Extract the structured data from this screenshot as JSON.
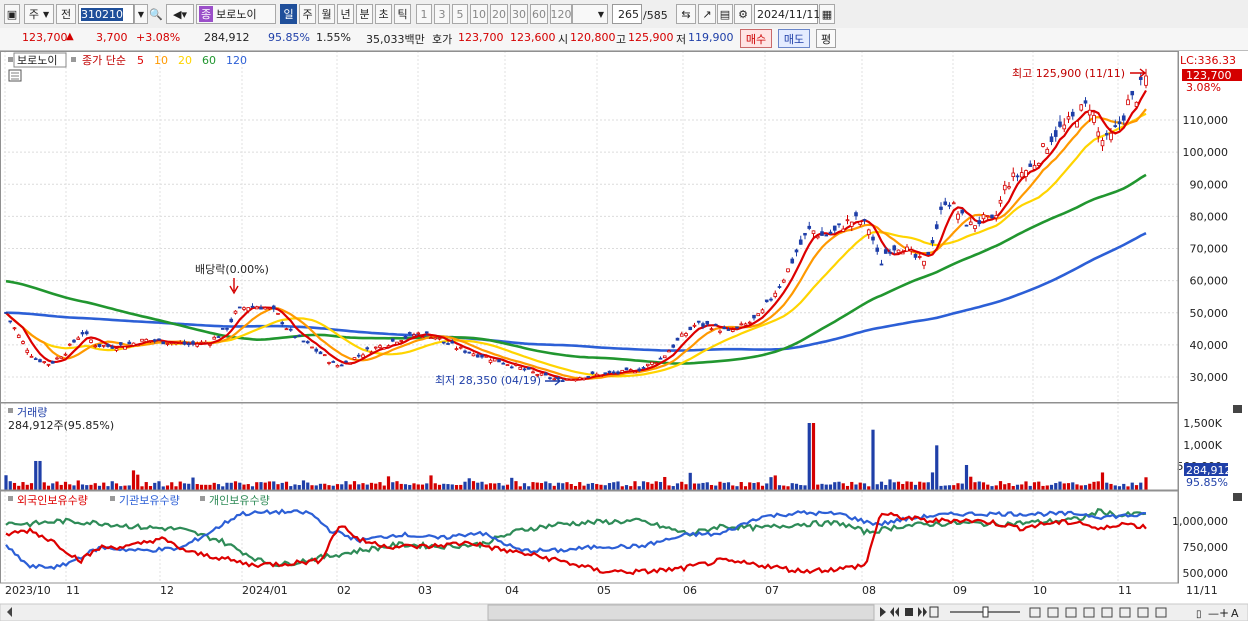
{
  "toolbar": {
    "market": "주",
    "prev_label": "전",
    "code": "310210",
    "stock_name": "보로노이",
    "periods": [
      "일",
      "주",
      "월",
      "년",
      "분",
      "초",
      "틱"
    ],
    "selected_period": "일",
    "intervals": [
      "1",
      "3",
      "5",
      "10",
      "20",
      "30",
      "60",
      "120"
    ],
    "count": "265",
    "total": "/585",
    "date": "2024/11/11"
  },
  "quote": {
    "price": "123,700",
    "change": "3,700",
    "change_pct": "+3.08%",
    "volume": "284,912",
    "vol_ratio": "95.85%",
    "turnover": "1.55%",
    "amount": "35,033백만",
    "hoga_label": "호가",
    "ask": "123,700",
    "bid": "123,600",
    "open_label": "시",
    "open": "120,800",
    "high_label": "고",
    "high": "125,900",
    "low_label": "저",
    "low": "119,900",
    "buy_label": "매수",
    "sell_label": "매도",
    "avg_label": "평",
    "up_color": "#d40000",
    "down_color": "#1f3fa8"
  },
  "price_panel": {
    "legend_name": "보로노이",
    "legend_ma": "종가 단순",
    "ma_periods": [
      "5",
      "10",
      "20",
      "60",
      "120"
    ],
    "ma_colors": [
      "#dd0000",
      "#ff9900",
      "#ffd400",
      "#21962f",
      "#2c5fd6"
    ],
    "lc_label": "LC:336.33",
    "current_tag": "123,700",
    "pct_tag": "3.08%",
    "high_note": "최고 125,900 (11/11)",
    "low_note": "최저 28,350 (04/19)",
    "div_note": "배당락(0.00%)",
    "y_ticks": [
      "110,000",
      "100,000",
      "90,000",
      "80,000",
      "70,000",
      "60,000",
      "50,000",
      "40,000",
      "30,000"
    ]
  },
  "volume_panel": {
    "title": "거래량",
    "value_text": "284,912주(95.85%)",
    "y_ticks": [
      "1,500K",
      "1,000K",
      "500,000"
    ],
    "current_tag": "284,912",
    "pct_tag": "95.85%"
  },
  "flow_panel": {
    "series_names": [
      "외국인보유수량",
      "기관보유수량",
      "개인보유수량"
    ],
    "series_colors": [
      "#dd0000",
      "#2c5fd6",
      "#2e8b57"
    ],
    "y_ticks": [
      "1,000,000",
      "750,000",
      "500,000"
    ]
  },
  "x_axis": [
    "2023/10",
    "11",
    "12",
    "2024/01",
    "02",
    "03",
    "04",
    "05",
    "06",
    "07",
    "08",
    "09",
    "10",
    "11",
    "11/11"
  ]
}
